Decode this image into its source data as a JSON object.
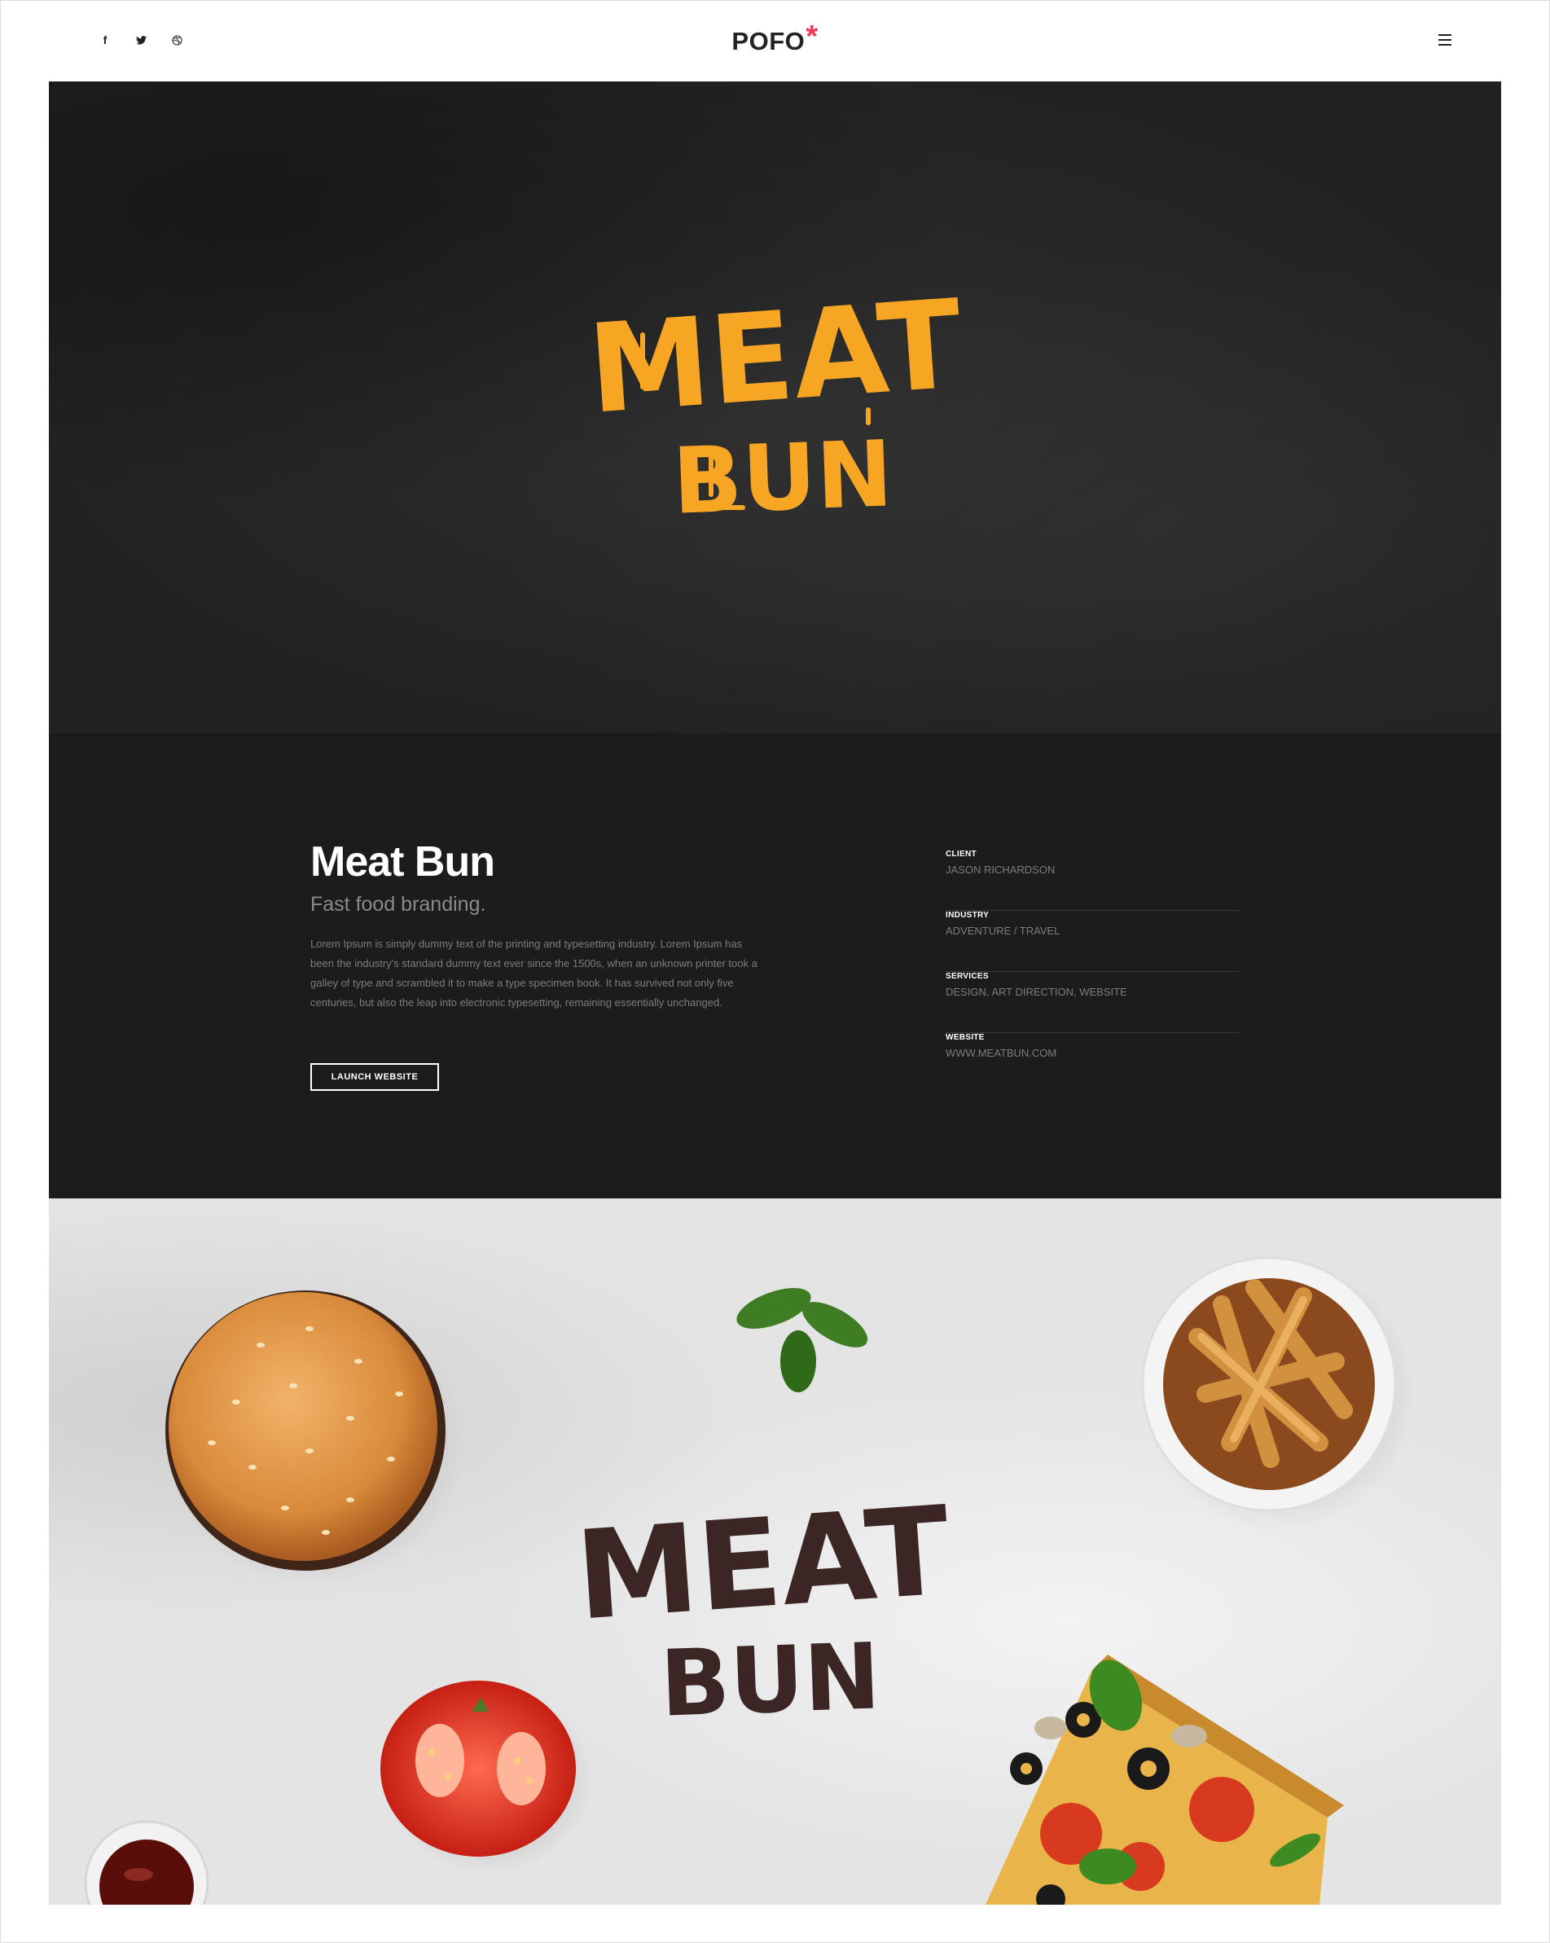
{
  "header": {
    "social": [
      {
        "icon": "facebook-icon",
        "glyph": "f"
      },
      {
        "icon": "twitter-icon",
        "glyph": "t"
      },
      {
        "icon": "dribbble-icon",
        "glyph": "d"
      }
    ],
    "logo_text": "POFO",
    "logo_star": "*",
    "accent_color": "#f5365c"
  },
  "hero": {
    "logo_line1": "MEAT",
    "logo_line2": "BUN",
    "logo_color": "#f6a623"
  },
  "project": {
    "title": "Meat Bun",
    "subtitle": "Fast food branding.",
    "description": "Lorem Ipsum is simply dummy text of the printing and typesetting industry. Lorem Ipsum has been the industry's standard dummy text ever since the 1500s, when an unknown printer took a galley of type and scrambled it to make a type specimen book. It has survived not only five centuries, but also the leap into electronic typesetting, remaining essentially unchanged.",
    "launch_label": "LAUNCH WEBSITE",
    "meta": [
      {
        "label": "CLIENT",
        "value": "JASON RICHARDSON"
      },
      {
        "label": "INDUSTRY",
        "value": "ADVENTURE / TRAVEL"
      },
      {
        "label": "SERVICES",
        "value": "DESIGN, ART DIRECTION, WEBSITE"
      },
      {
        "label": "WEBSITE",
        "value": "WWW.MEATBUN.COM"
      }
    ]
  },
  "food_photo": {
    "logo_line1": "MEAT",
    "logo_line2": "BUN",
    "logo_color": "#3b2525"
  }
}
